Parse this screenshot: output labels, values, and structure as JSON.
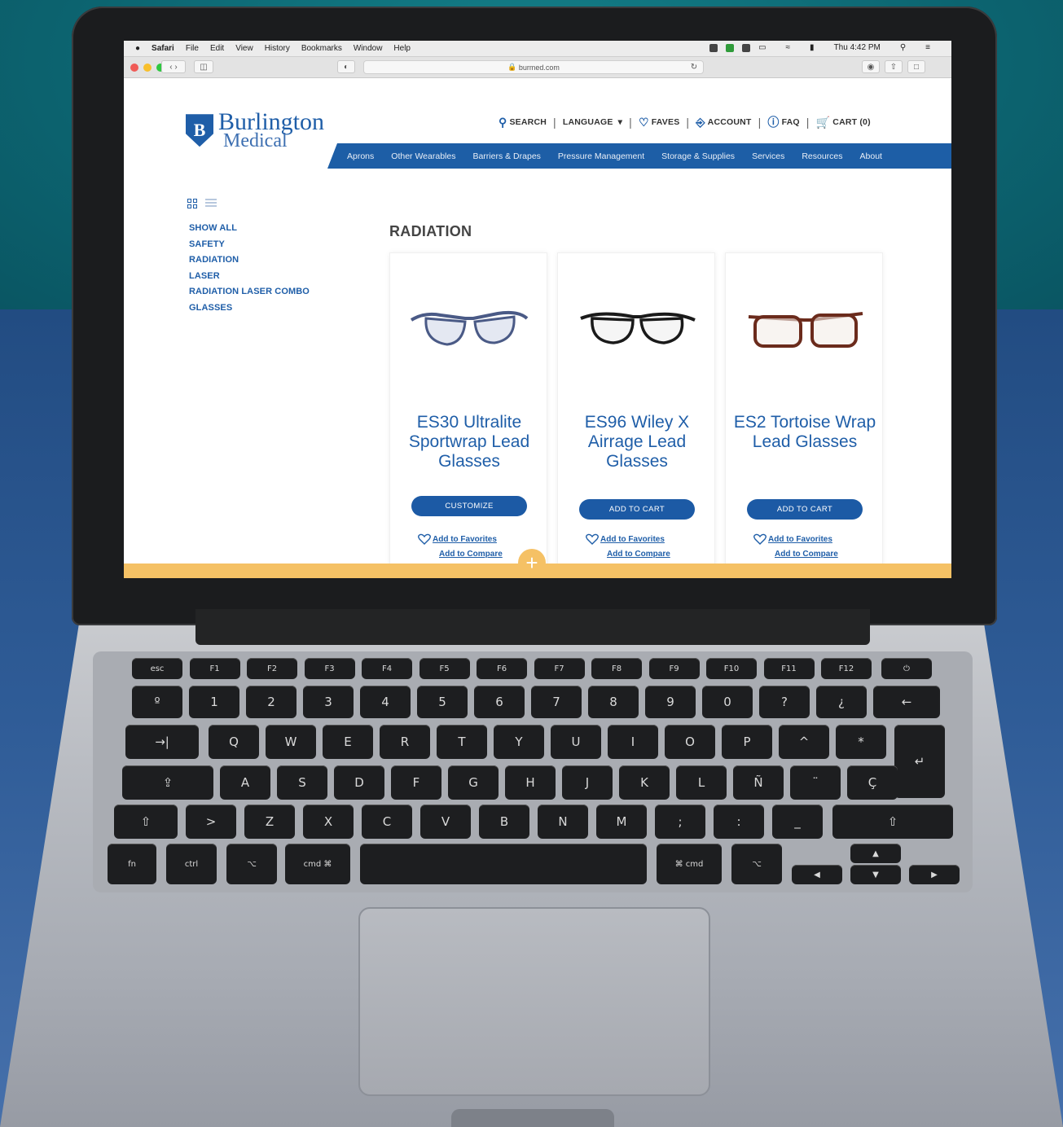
{
  "menubar": {
    "app": "Safari",
    "items": [
      "File",
      "Edit",
      "View",
      "History",
      "Bookmarks",
      "Window",
      "Help"
    ],
    "clock": "Thu 4:42 PM"
  },
  "browser": {
    "url": "burmed.com"
  },
  "brand": {
    "line1": "Burlington",
    "line2": "Medical",
    "mark": "B",
    "color": "#1f5ea8"
  },
  "utility": {
    "search": "SEARCH",
    "language": "LANGUAGE",
    "faves": "FAVES",
    "account": "ACCOUNT",
    "faq": "FAQ",
    "cart": "CART (0)"
  },
  "nav": [
    "Aprons",
    "Other Wearables",
    "Barriers & Drapes",
    "Pressure Management",
    "Storage & Supplies",
    "Services",
    "Resources",
    "About"
  ],
  "sidebar": {
    "categories": [
      "SHOW ALL",
      "SAFETY",
      "RADIATION",
      "LASER",
      "RADIATION LASER COMBO",
      "GLASSES"
    ]
  },
  "page": {
    "heading": "RADIATION"
  },
  "products": [
    {
      "name": "ES30 Ultralite Sportwrap Lead Glasses",
      "cta": "CUSTOMIZE",
      "favorite": "Add to Favorites",
      "compare": "Add to Compare",
      "frame": "#4a5a86"
    },
    {
      "name": "ES96 Wiley X Airrage Lead Glasses",
      "cta": "ADD TO CART",
      "favorite": "Add to Favorites",
      "compare": "Add to Compare",
      "frame": "#1a1a1a"
    },
    {
      "name": "ES2 Tortoise Wrap Lead Glasses",
      "cta": "ADD TO CART",
      "favorite": "Add to Favorites",
      "compare": "Add to Compare",
      "frame": "#6b2b1c"
    }
  ],
  "keyboard": {
    "fn_row": [
      "esc",
      "F1",
      "F2",
      "F3",
      "F4",
      "F5",
      "F6",
      "F7",
      "F8",
      "F9",
      "F10",
      "F11",
      "F12"
    ],
    "num_row": [
      "º",
      "1",
      "2",
      "3",
      "4",
      "5",
      "6",
      "7",
      "8",
      "9",
      "0",
      "?",
      "¿"
    ],
    "q_row": [
      "Q",
      "W",
      "E",
      "R",
      "T",
      "Y",
      "U",
      "I",
      "O",
      "P",
      "^",
      "*"
    ],
    "a_row": [
      "A",
      "S",
      "D",
      "F",
      "G",
      "H",
      "J",
      "K",
      "L",
      "Ñ",
      "¨",
      "Ç"
    ],
    "z_row": [
      ">",
      "Z",
      "X",
      "C",
      "V",
      "B",
      "N",
      "M",
      ";",
      ":",
      "_"
    ],
    "mods": {
      "fn": "fn",
      "ctrl": "ctrl",
      "cmd_left": "cmd ⌘",
      "cmd_right": "⌘ cmd"
    }
  }
}
